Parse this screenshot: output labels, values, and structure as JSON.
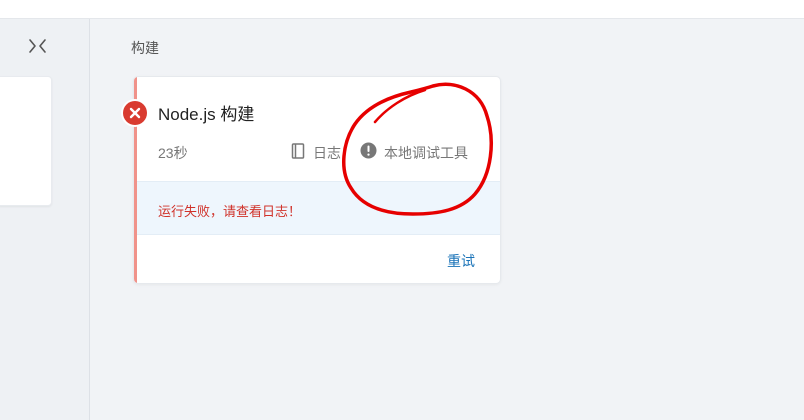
{
  "build": {
    "section_title": "构建",
    "card_title": "Node.js 构建",
    "duration": "23秒",
    "log_label": "日志",
    "debug_label": "本地调试工具",
    "error_message": "运行失败，请查看日志！",
    "retry_label": "重试",
    "status": "failed"
  },
  "icons": {
    "collapse": "collapse-arrows-icon",
    "status": "error-x-icon",
    "log": "book-icon",
    "debug": "info-circle-icon"
  },
  "colors": {
    "error": "#d93b30",
    "error_text": "#d0322a",
    "link": "#1a73b8",
    "error_band": "#eef6fd",
    "accent_bar": "#f0928a",
    "annotation": "#e60000"
  }
}
